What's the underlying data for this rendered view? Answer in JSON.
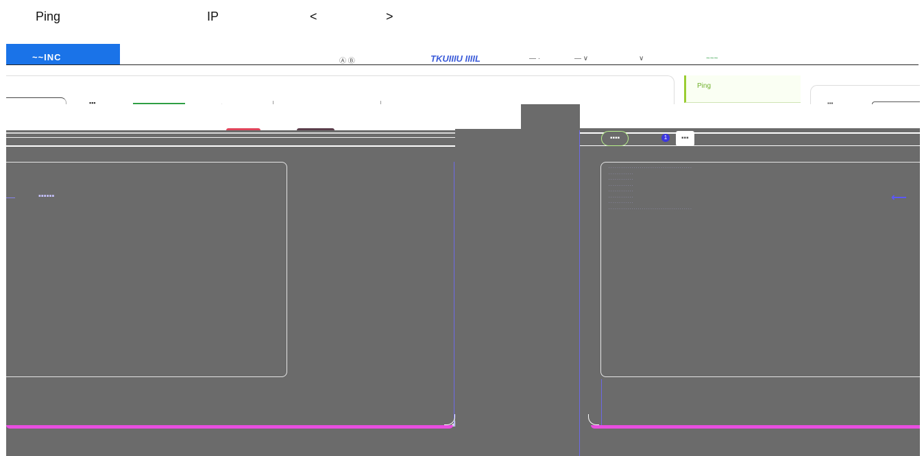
{
  "caption": {
    "word1": "Ping",
    "word2": "IP",
    "word3": "<",
    "word4": ">"
  },
  "colors": {
    "accent_blue": "#1a73e8",
    "panel_gray": "#6b6b6b",
    "tab_green": "#6fb02a",
    "pink_bar": "#e84ee0",
    "badge_blue": "#3d36e0"
  },
  "header": {
    "logo_text": "~~INC",
    "brand_text": "TKUIIIU IIIIL",
    "center_items": [
      "Ⓐ Ⓑ",
      "— ·",
      "— ∨",
      "∨"
    ],
    "right_text": "~~~"
  },
  "tabs": {
    "active_label": "Ping"
  },
  "form": {
    "title": "▪▪▪",
    "field_label": "* ▪▪▪▪ :",
    "field_value": "▪▪  ▪",
    "extra": "▪▪▪▪"
  },
  "side_card_text": "▪▪▪",
  "left_panel": {
    "hint": "▪▪▪▪▪▪"
  },
  "right_panel": {
    "start_label": "▪▪▪▪",
    "badge": "1",
    "stop_label": "▪▪▪",
    "log_lines": [
      "· · · · · · · · · · · · · · · · · · · · · · · · · · · · · · · · · · · · · · · ·",
      "· · · · · · · · · · · ·",
      "· · · · · · · · · · · ·",
      "· · · · · · · · · · · ·",
      "· · · · · · · · · · · ·",
      "· · · · · · · · · · · ·",
      "· · · · · · · · · · · ·",
      "· · · · · · · · · · · · · · · · · · · · · · · · · · · · · · · · · · · · · · · ·"
    ]
  }
}
